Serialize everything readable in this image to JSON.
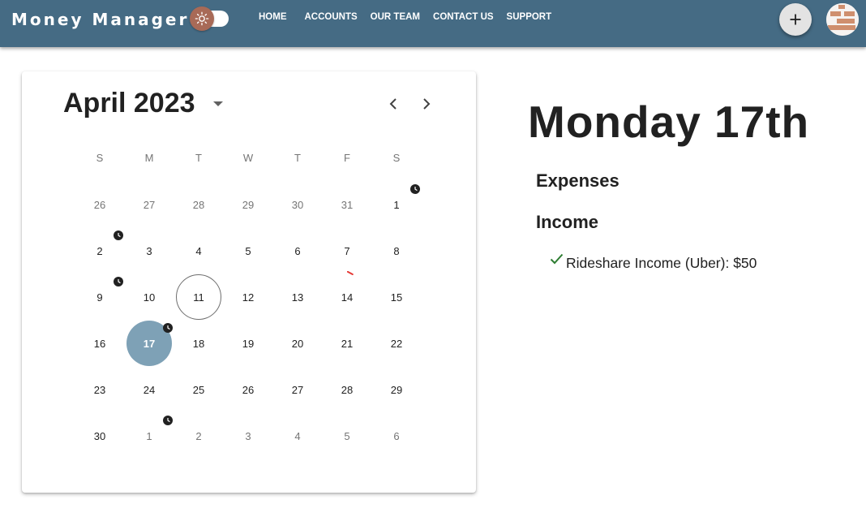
{
  "app": {
    "brand": "Money Manager",
    "nav": [
      "HOME",
      "ACCOUNTS",
      "OUR TEAM",
      "CONTACT US",
      "SUPPORT"
    ],
    "theme_toggle_icon": "sun-icon",
    "add_button_icon": "plus-icon",
    "avatar_icon": "user-avatar"
  },
  "calendar": {
    "month_label": "April 2023",
    "weekdays": [
      "S",
      "M",
      "T",
      "W",
      "T",
      "F",
      "S"
    ],
    "weeks": [
      [
        "26",
        "27",
        "28",
        "29",
        "30",
        "31",
        "1"
      ],
      [
        "2",
        "3",
        "4",
        "5",
        "6",
        "7",
        "8"
      ],
      [
        "9",
        "10",
        "11",
        "12",
        "13",
        "14",
        "15"
      ],
      [
        "16",
        "17",
        "18",
        "19",
        "20",
        "21",
        "22"
      ],
      [
        "23",
        "24",
        "25",
        "26",
        "27",
        "28",
        "29"
      ],
      [
        "30",
        "1",
        "2",
        "3",
        "4",
        "5",
        "6"
      ]
    ],
    "today": "11",
    "selected": "17",
    "clock_marked_days": [
      "1",
      "2",
      "9",
      "17",
      "1 (May)"
    ],
    "red_marked_days": [
      "7"
    ]
  },
  "detail": {
    "date_heading": "Monday 17th",
    "expenses_label": "Expenses",
    "income_label": "Income",
    "income_items": [
      {
        "label": "Rideshare Income (Uber): $50",
        "status": "check-icon"
      }
    ]
  },
  "colors": {
    "topbar": "#456b84",
    "selected_day": "#7ea1b6",
    "toggle_thumb": "#a86a57",
    "check": "#2e7d32",
    "avatar_accent": "#cf8f6e"
  }
}
